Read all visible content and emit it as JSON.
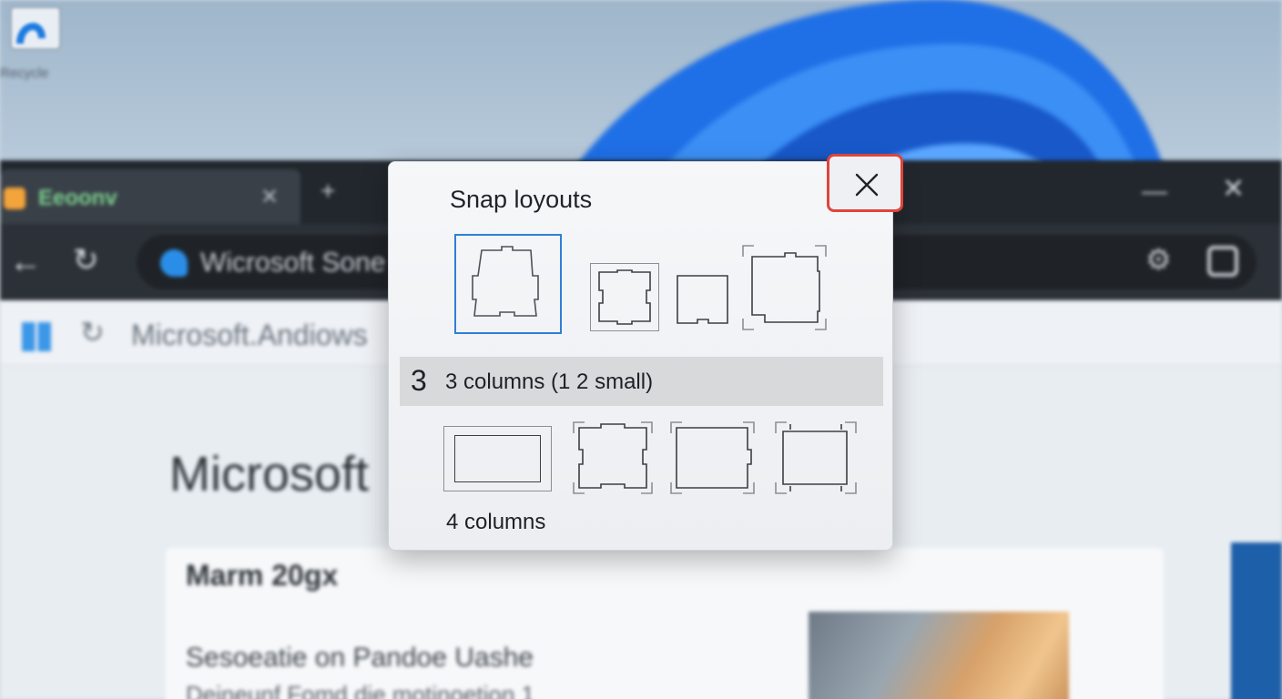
{
  "desktop": {
    "icon_name": "computer-icon",
    "icon_label": "Recycle"
  },
  "browser": {
    "tab": {
      "title": "Eeoonv",
      "favicon": "shield-icon"
    },
    "address_bar": {
      "text": "Wicrosoft Sone"
    },
    "bookmark_bar": {
      "text": "Microsoft.Andiows"
    },
    "page": {
      "heading": "Microsoft",
      "card_title": "Marm 20gx",
      "card_subtitle": "Sesoeatie on Pandoe Uashe",
      "card_subtitle2": "Deineunf Fomd die motinoetion 1"
    }
  },
  "snap_layouts": {
    "title": "Snap loyouts",
    "close_icon": "close-icon",
    "highlight": {
      "number": "3",
      "label": "3 columns (1 2 small)"
    },
    "bottom_label": "4 columns",
    "colors": {
      "selection": "#2f7fd6",
      "close_outline": "#e0443a",
      "row_highlight": "#d8d9db"
    }
  }
}
